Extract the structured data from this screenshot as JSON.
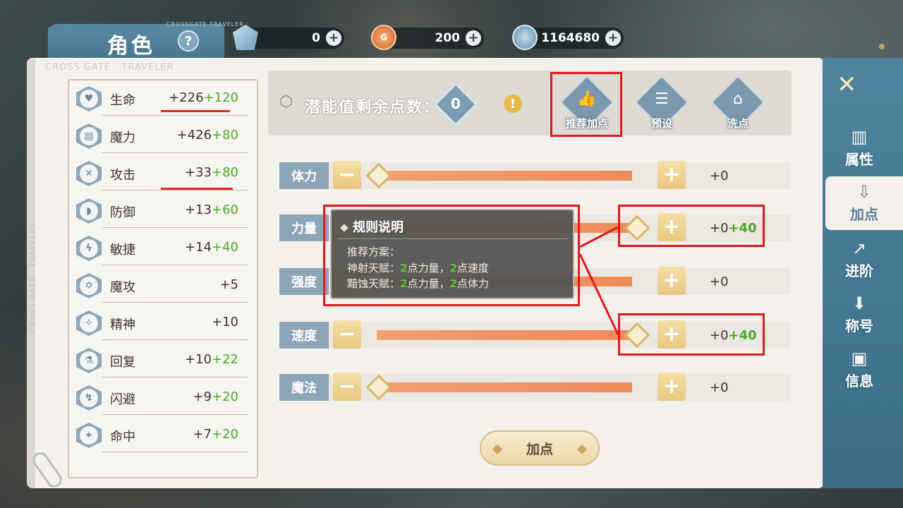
{
  "header": {
    "title": "角色",
    "help_icon": "?",
    "stamp": "CROSSGATE.TRAVELER",
    "currencies": [
      {
        "name": "gem",
        "value": "0",
        "color": "#8fb9d6"
      },
      {
        "name": "coin",
        "value": "200",
        "color": "#e77b3f"
      },
      {
        "name": "silver",
        "value": "1164680",
        "color": "#5f8fb2"
      }
    ],
    "plus": "+"
  },
  "panel": {
    "watermark": "CROSS GATE . TRAVELER",
    "watermark_vertical": "CROSS GATE . TRAVELER"
  },
  "stats": [
    {
      "name": "生命",
      "base": "+226",
      "bonus": "+120",
      "icon": "heart-icon"
    },
    {
      "name": "魔力",
      "base": "+426",
      "bonus": "+80",
      "icon": "book-icon"
    },
    {
      "name": "攻击",
      "base": "+33",
      "bonus": "+80",
      "icon": "swords-icon"
    },
    {
      "name": "防御",
      "base": "+13",
      "bonus": "+60",
      "icon": "shield-icon"
    },
    {
      "name": "敏捷",
      "base": "+14",
      "bonus": "+40",
      "icon": "lightning-icon"
    },
    {
      "name": "魔攻",
      "base": "+5",
      "bonus": "",
      "icon": "hexagram-icon"
    },
    {
      "name": "精神",
      "base": "+10",
      "bonus": "",
      "icon": "compass-icon"
    },
    {
      "name": "回复",
      "base": "+10",
      "bonus": "+22",
      "icon": "flask-icon"
    },
    {
      "name": "闪避",
      "base": "+9",
      "bonus": "+20",
      "icon": "dodge-icon"
    },
    {
      "name": "命中",
      "base": "+7",
      "bonus": "+20",
      "icon": "crosshair-icon"
    }
  ],
  "potential": {
    "label": "潜能值剩余点数：",
    "value": "0",
    "warn": "!"
  },
  "tools": [
    {
      "label": "推荐加点",
      "icon": "thumbs-up-icon"
    },
    {
      "label": "预设",
      "icon": "sliders-icon"
    },
    {
      "label": "洗点",
      "icon": "broom-icon"
    }
  ],
  "attributes": [
    {
      "name": "体力",
      "base": "+0",
      "bonus": "",
      "fill": 0.0
    },
    {
      "name": "力量",
      "base": "+0",
      "bonus": "+40",
      "fill": 1.0
    },
    {
      "name": "强度",
      "base": "+0",
      "bonus": "",
      "fill": 0.0
    },
    {
      "name": "速度",
      "base": "+0",
      "bonus": "+40",
      "fill": 1.0
    },
    {
      "name": "魔法",
      "base": "+0",
      "bonus": "",
      "fill": 0.0
    }
  ],
  "controls": {
    "minus": "−",
    "plus": "+"
  },
  "tooltip": {
    "title": "规则说明",
    "heading": "推荐方案：",
    "lines": [
      {
        "prefix": "神射天赋：",
        "n1": "2",
        "a1": "点力量，",
        "n2": "2",
        "a2": "点速度"
      },
      {
        "prefix": "黯蚀天赋：",
        "n1": "2",
        "a1": "点力量，",
        "n2": "2",
        "a2": "点体力"
      }
    ]
  },
  "confirm_label": "加点",
  "sidebar": {
    "close": "✕",
    "items": [
      {
        "label": "属性",
        "icon": "chart-icon",
        "active": false
      },
      {
        "label": "加点",
        "icon": "inbox-down-icon",
        "active": true
      },
      {
        "label": "进阶",
        "icon": "trend-up-icon",
        "active": false
      },
      {
        "label": "称号",
        "icon": "badge-icon",
        "active": false
      },
      {
        "label": "信息",
        "icon": "profile-icon",
        "active": false
      }
    ]
  },
  "colors": {
    "accent_blue": "#8ca5b7",
    "bonus_green": "#4da624",
    "highlight_red": "#e0191d",
    "slider_orange": "#ee8a5a"
  }
}
